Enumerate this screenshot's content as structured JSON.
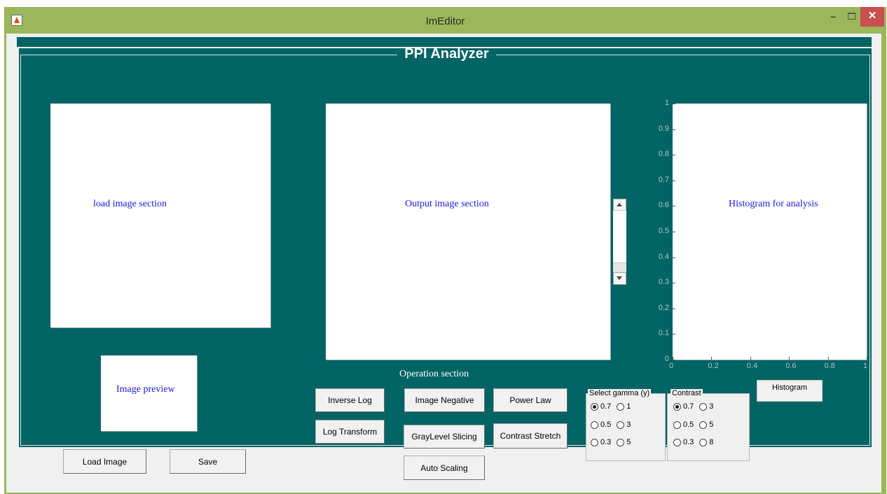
{
  "window": {
    "title": "ImEditor",
    "minimize": "–",
    "close": "✕"
  },
  "panel": {
    "title": "PPI Analyzer"
  },
  "axes": {
    "load": "load image section",
    "output": "Output image section",
    "preview": "Image preview",
    "histogram": "Histogram for analysis"
  },
  "histogram_axis": {
    "y_ticks": [
      "1",
      "0.9",
      "0.8",
      "0.7",
      "0.6",
      "0.5",
      "0.4",
      "0.3",
      "0.2",
      "0.1",
      "0"
    ],
    "x_ticks": [
      "0",
      "0.2",
      "0.4",
      "0.6",
      "0.8",
      "1"
    ]
  },
  "operation_label": "Operation section",
  "buttons": {
    "load_image": "Load Image",
    "save": "Save",
    "inverse_log": "Inverse Log",
    "log_transform": "Log Transform",
    "image_negative": "Image Negative",
    "gray_level_slicing": "GrayLevel Slicing",
    "auto_scaling": "Auto Scaling",
    "power_law": "Power Law",
    "contrast_stretch": "Contrast Stretch",
    "histogram": "Histogram"
  },
  "gamma_group": {
    "title": "Select gamma (y)",
    "options": [
      "0.7",
      "1",
      "0.5",
      "3",
      "0.3",
      "5"
    ],
    "selected": "0.7"
  },
  "contrast_group": {
    "title": "Contrast",
    "options": [
      "0.7",
      "3",
      "0.5",
      "5",
      "0.3",
      "8"
    ],
    "selected": "0.7"
  },
  "colors": {
    "titlebar": "#9bb75a",
    "panel": "#006464",
    "axes_label": "#1a1aee",
    "close_button": "#c75050"
  }
}
